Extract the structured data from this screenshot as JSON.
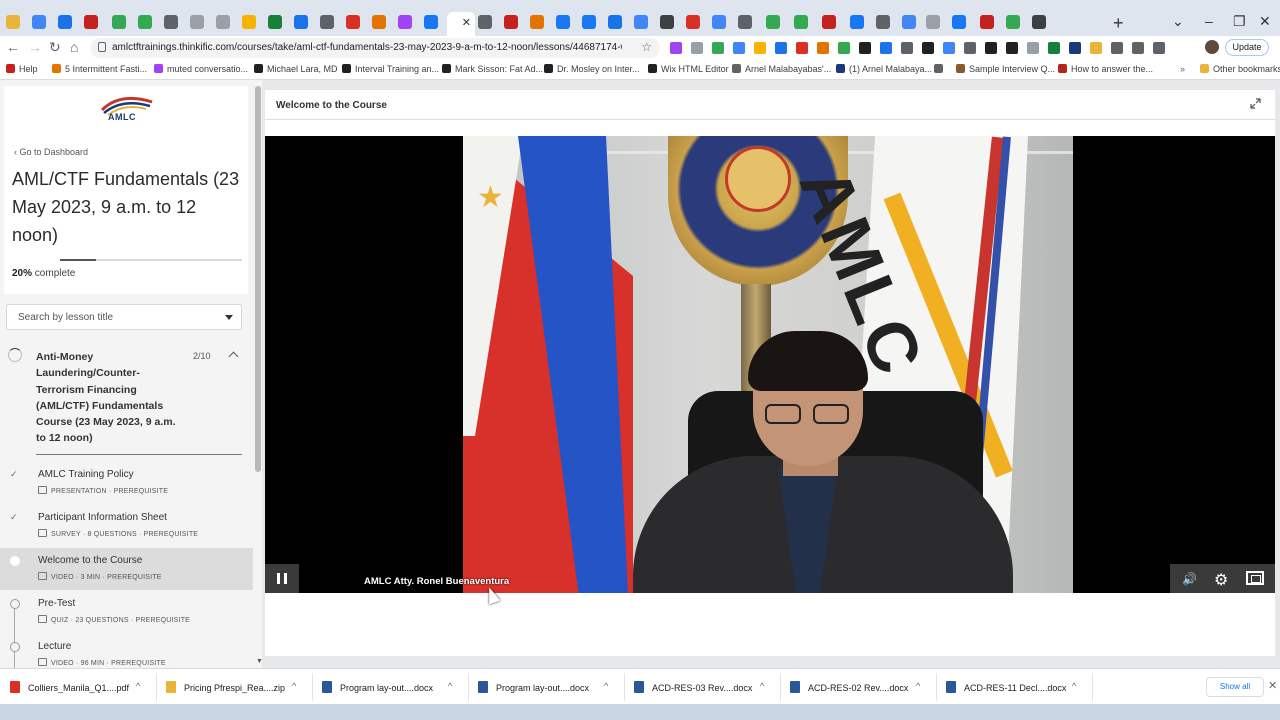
{
  "browser": {
    "url": "amlctftrainings.thinkific.com/courses/take/aml-ctf-fundamentals-23-may-2023-9-a-m-to-12-noon/lessons/44687174-w...",
    "update_label": "Update",
    "other_bookmarks": "Other bookmarks",
    "bookmarks": [
      {
        "label": "Help",
        "color": "#c5221f"
      },
      {
        "label": "5 Intermittent Fasti...",
        "color": "#e37400"
      },
      {
        "label": "muted conversatio...",
        "color": "#a142f4"
      },
      {
        "label": "Michael Lara, MD",
        "color": "#202124"
      },
      {
        "label": "Interval Training an...",
        "color": "#202124"
      },
      {
        "label": "Mark Sisson: Fat Ad...",
        "color": "#202124"
      },
      {
        "label": "Dr. Mosley on Inter...",
        "color": "#202124"
      },
      {
        "label": "Wix HTML Editor",
        "color": "#202124"
      },
      {
        "label": "Arnel Malabayabas'...",
        "color": "#5f6368"
      },
      {
        "label": "(1) Arnel Malabaya...",
        "color": "#1a3a7a"
      },
      {
        "label": "",
        "color": "#5f6368"
      },
      {
        "label": "Sample Interview Q...",
        "color": "#8a5a2a"
      },
      {
        "label": "How to answer the...",
        "color": "#b3261e"
      }
    ]
  },
  "sidebar": {
    "logo_text": "AMLC",
    "back_link": "Go to Dashboard",
    "course_title": "AML/CTF Fundamentals (23 May 2023, 9 a.m. to 12 noon)",
    "progress_percent": 20,
    "progress_value": "20%",
    "progress_suffix": "complete",
    "search_placeholder": "Search by lesson title",
    "chapter": {
      "title": "Anti-Money Laundering/Counter-Terrorism Financing (AML/CTF) Fundamentals Course (23 May 2023, 9 a.m. to 12 noon)",
      "count": "2/10"
    },
    "lessons": [
      {
        "name": "AMLC Training Policy",
        "meta": "PRESENTATION · PREREQUISITE",
        "done": true,
        "active": false
      },
      {
        "name": "Participant Information Sheet",
        "meta": "SURVEY · 8 QUESTIONS · PREREQUISITE",
        "done": true,
        "active": false
      },
      {
        "name": "Welcome to the Course",
        "meta": "VIDEO · 3 MIN · PREREQUISITE",
        "done": false,
        "active": true
      },
      {
        "name": "Pre-Test",
        "meta": "QUIZ · 23 QUESTIONS · PREREQUISITE",
        "done": false,
        "active": false
      },
      {
        "name": "Lecture",
        "meta": "VIDEO · 96 MIN · PREREQUISITE",
        "done": false,
        "active": false
      }
    ]
  },
  "content": {
    "lesson_title": "Welcome to the Course",
    "video": {
      "caption": "AMLC Atty. Ronel Buenaventura",
      "flag_letters": "AMLC"
    }
  },
  "downloads": {
    "items": [
      {
        "name": "Colliers_Manila_Q1....pdf",
        "color": "#d93025"
      },
      {
        "name": "Pricing Pfrespi_Rea....zip",
        "color": "#e8b43a"
      },
      {
        "name": "Program lay-out....docx",
        "color": "#2b579a"
      },
      {
        "name": "Program lay-out....docx",
        "color": "#2b579a"
      },
      {
        "name": "ACD-RES-03 Rev....docx",
        "color": "#2b579a"
      },
      {
        "name": "ACD-RES-02 Rev....docx",
        "color": "#2b579a"
      },
      {
        "name": "ACD-RES-11 Decl....docx",
        "color": "#2b579a"
      }
    ],
    "show_all": "Show all"
  }
}
